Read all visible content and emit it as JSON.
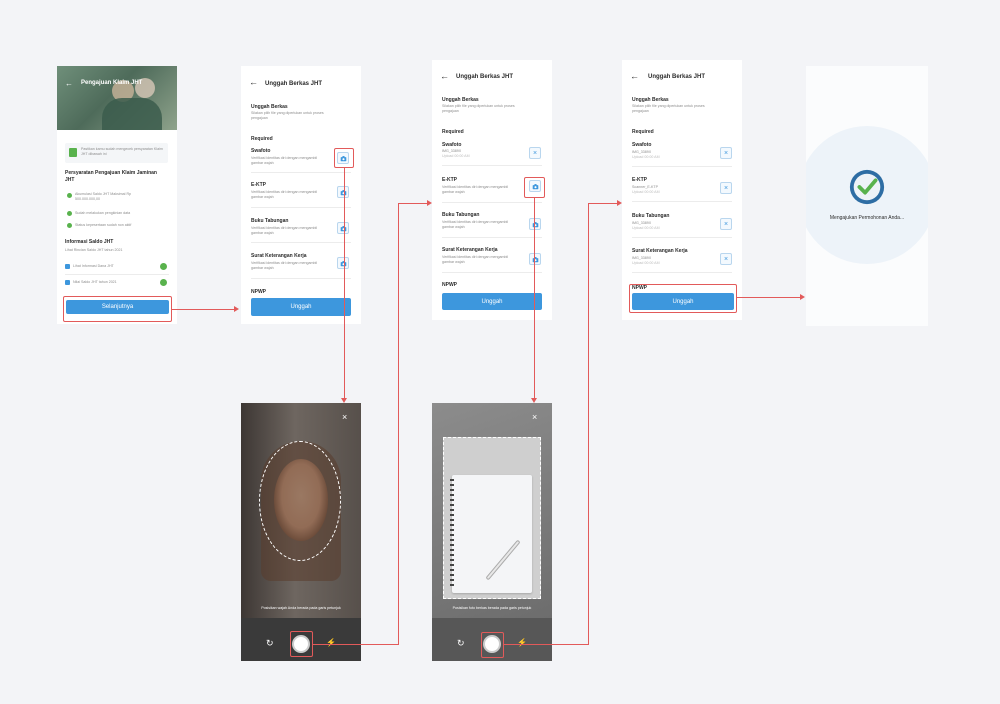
{
  "s1": {
    "title": "Pengajuan Klaim JHT",
    "notice": "Pastikan kamu sudah mengecek persyaratan Klaim JHT dibawah ini",
    "req_title": "Persyaratan Pengajuan Klaim Jaminan JHT",
    "reqs": [
      "Akumulasi Saldo JHT Maksimal Rp 500.000.000,00",
      "Sudah melakukan pengkinian data",
      "Status kepesertaan sudah non aktif"
    ],
    "info_title": "Informasi Saldo JHT",
    "info_sub": "Lihat Rincian Saldo JHT tahun 2021",
    "links": [
      "Lihat Informasi Dana JHT",
      "Nilai Saldo JHT tahun 2021"
    ],
    "button": "Selanjutnya"
  },
  "upload": {
    "title": "Unggah Berkas JHT",
    "section": "Unggah Berkas",
    "section_desc": "Silakan pilih file yang diperlukan untuk proses pengajuan",
    "required": "Required",
    "items": [
      {
        "name": "Swafoto",
        "desc": "Verifikasi identitas diri dengan mengambil gambar wajah"
      },
      {
        "name": "E-KTP",
        "desc": "Verifikasi identitas diri dengan mengambil gambar wajah"
      },
      {
        "name": "Buku Tabungan",
        "desc": "Verifikasi identitas diri dengan mengambil gambar wajah"
      },
      {
        "name": "Surat Keterangan Kerja",
        "desc": "Verifikasi identitas diri dengan mengambil gambar wajah"
      },
      {
        "name": "NPWP",
        "desc": ""
      }
    ],
    "button": "Unggah"
  },
  "s3_files": [
    {
      "file": "IMG_3389X",
      "date": "Upload 00:00 AM"
    }
  ],
  "s4_files": [
    {
      "file": "IMG_3389X",
      "date": "Upload 00:00 AM"
    },
    {
      "file": "Scanner_E-KTP",
      "date": "Upload 00:00 AM"
    },
    {
      "file": "IMG_3389X",
      "date": "Upload 00:00 AM"
    },
    {
      "file": "IMG_3389X",
      "date": "Upload 00:00 AM"
    }
  ],
  "success": {
    "text": "Mengajukan Permohonan Anda..."
  },
  "camera1": {
    "hint": "Posisikan wajah Anda berada pada garis petunjuk"
  },
  "camera2": {
    "hint": "Posisikan foto berkas berada pada garis petunjuk"
  },
  "colors": {
    "accent": "#3d97dd",
    "flow": "#e25a5a",
    "check": "#59b24d"
  }
}
